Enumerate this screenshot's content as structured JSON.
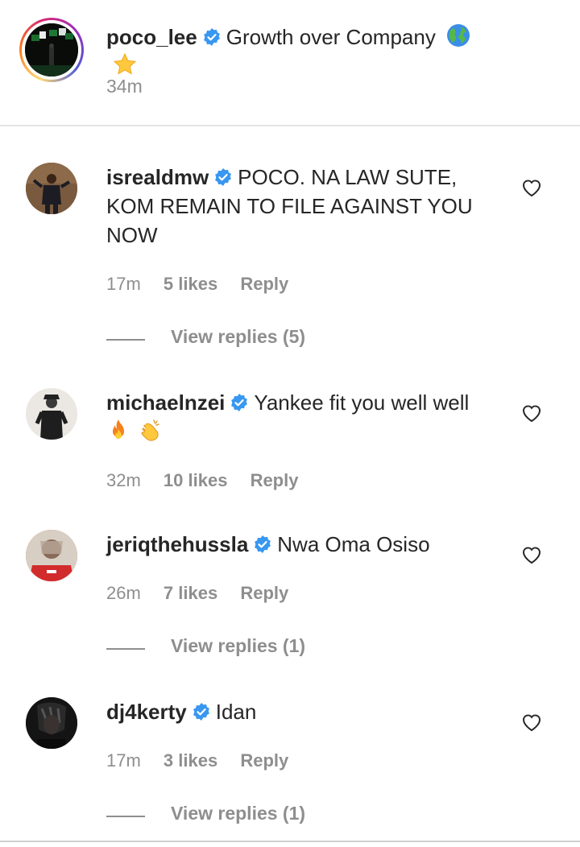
{
  "caption": {
    "username": "poco_lee",
    "text": "Growth over Company",
    "emojis": [
      "globe-icon",
      "star-icon"
    ],
    "time": "34m"
  },
  "comments": [
    {
      "username": "isrealdmw",
      "text": "POCO. NA LAW SUTE, KOM REMAIN TO FILE AGAINST YOU NOW",
      "time": "17m",
      "likes": "5 likes",
      "reply": "Reply",
      "view_replies": "View replies (5)"
    },
    {
      "username": "michaelnzei",
      "text": "Yankee fit you well well",
      "emojis": [
        "fire-icon",
        "clapping-hands-icon"
      ],
      "time": "32m",
      "likes": "10 likes",
      "reply": "Reply"
    },
    {
      "username": "jeriqthehussla",
      "text": "Nwa Oma Osiso",
      "time": "26m",
      "likes": "7 likes",
      "reply": "Reply",
      "view_replies": "View replies (1)"
    },
    {
      "username": "dj4kerty",
      "text": "Idan",
      "time": "17m",
      "likes": "3 likes",
      "reply": "Reply",
      "view_replies": "View replies (1)"
    }
  ],
  "colors": {
    "verified": "#3897f0",
    "meta": "#8e8e8e",
    "text": "#262626"
  }
}
